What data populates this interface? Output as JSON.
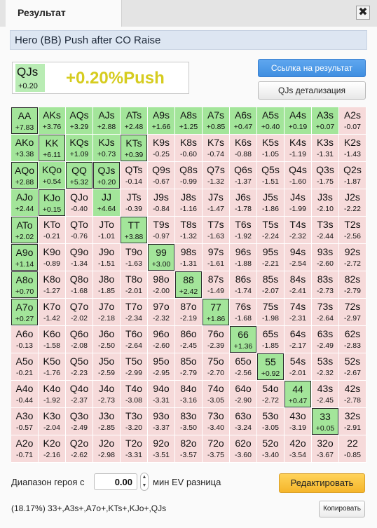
{
  "window": {
    "tab_title": "Результат",
    "close_glyph": "✖"
  },
  "scenario_title": "Hero (BB) Push after CO Raise",
  "selected_hand": {
    "name": "QJs",
    "ev": "+0.20",
    "result_text": "+0.20%Push"
  },
  "buttons": {
    "link": "Ссылка на результат",
    "details": "QJs детализация",
    "edit": "Редактировать",
    "copy": "Копировать"
  },
  "range": {
    "label": "Диапазон героя с",
    "value": "0.00",
    "suffix": "мин EV разница"
  },
  "summary": "(18.17%) 33+,A3s+,A7o+,KTs+,KJo+,QJs",
  "colors": {
    "push_green": "#a3e59a",
    "fold_pink": "#f6dada",
    "selected_green": "#b9ecb4",
    "result_yellow": "#d6cc1f",
    "link_button": "#4a97e8",
    "edit_button": "#f8c23f"
  },
  "grid": [
    [
      {
        "n": "AA",
        "v": "+7.83",
        "p": true,
        "s": true
      },
      {
        "n": "AKs",
        "v": "+3.76",
        "p": true,
        "s": false
      },
      {
        "n": "AQs",
        "v": "+3.29",
        "p": true,
        "s": false
      },
      {
        "n": "AJs",
        "v": "+2.88",
        "p": true,
        "s": false
      },
      {
        "n": "ATs",
        "v": "+2.48",
        "p": true,
        "s": false
      },
      {
        "n": "A9s",
        "v": "+1.66",
        "p": true,
        "s": false
      },
      {
        "n": "A8s",
        "v": "+1.25",
        "p": true,
        "s": false
      },
      {
        "n": "A7s",
        "v": "+0.85",
        "p": true,
        "s": false
      },
      {
        "n": "A6s",
        "v": "+0.47",
        "p": true,
        "s": false
      },
      {
        "n": "A5s",
        "v": "+0.40",
        "p": true,
        "s": false
      },
      {
        "n": "A4s",
        "v": "+0.19",
        "p": true,
        "s": false
      },
      {
        "n": "A3s",
        "v": "+0.07",
        "p": true,
        "s": false
      },
      {
        "n": "A2s",
        "v": "-0.07",
        "p": false,
        "s": false
      }
    ],
    [
      {
        "n": "AKo",
        "v": "+3.38",
        "p": true,
        "s": false
      },
      {
        "n": "KK",
        "v": "+6.11",
        "p": true,
        "s": true
      },
      {
        "n": "KQs",
        "v": "+1.09",
        "p": true,
        "s": false
      },
      {
        "n": "KJs",
        "v": "+0.73",
        "p": true,
        "s": false
      },
      {
        "n": "KTs",
        "v": "+0.39",
        "p": true,
        "s": true
      },
      {
        "n": "K9s",
        "v": "-0.25",
        "p": false,
        "s": false
      },
      {
        "n": "K8s",
        "v": "-0.60",
        "p": false,
        "s": false
      },
      {
        "n": "K7s",
        "v": "-0.74",
        "p": false,
        "s": false
      },
      {
        "n": "K6s",
        "v": "-0.88",
        "p": false,
        "s": false
      },
      {
        "n": "K5s",
        "v": "-1.05",
        "p": false,
        "s": false
      },
      {
        "n": "K4s",
        "v": "-1.19",
        "p": false,
        "s": false
      },
      {
        "n": "K3s",
        "v": "-1.31",
        "p": false,
        "s": false
      },
      {
        "n": "K2s",
        "v": "-1.43",
        "p": false,
        "s": false
      }
    ],
    [
      {
        "n": "AQo",
        "v": "+2.88",
        "p": true,
        "s": true
      },
      {
        "n": "KQo",
        "v": "+0.54",
        "p": true,
        "s": false
      },
      {
        "n": "QQ",
        "v": "+5.32",
        "p": true,
        "s": true
      },
      {
        "n": "QJs",
        "v": "+0.20",
        "p": true,
        "s": true
      },
      {
        "n": "QTs",
        "v": "-0.14",
        "p": false,
        "s": false
      },
      {
        "n": "Q9s",
        "v": "-0.67",
        "p": false,
        "s": false
      },
      {
        "n": "Q8s",
        "v": "-0.99",
        "p": false,
        "s": false
      },
      {
        "n": "Q7s",
        "v": "-1.32",
        "p": false,
        "s": false
      },
      {
        "n": "Q6s",
        "v": "-1.37",
        "p": false,
        "s": false
      },
      {
        "n": "Q5s",
        "v": "-1.51",
        "p": false,
        "s": false
      },
      {
        "n": "Q4s",
        "v": "-1.60",
        "p": false,
        "s": false
      },
      {
        "n": "Q3s",
        "v": "-1.75",
        "p": false,
        "s": false
      },
      {
        "n": "Q2s",
        "v": "-1.87",
        "p": false,
        "s": false
      }
    ],
    [
      {
        "n": "AJo",
        "v": "+2.44",
        "p": true,
        "s": false
      },
      {
        "n": "KJo",
        "v": "+0.15",
        "p": true,
        "s": true
      },
      {
        "n": "QJo",
        "v": "-0.40",
        "p": false,
        "s": false
      },
      {
        "n": "JJ",
        "v": "+4.64",
        "p": true,
        "s": false
      },
      {
        "n": "JTs",
        "v": "-0.39",
        "p": false,
        "s": false
      },
      {
        "n": "J9s",
        "v": "-0.84",
        "p": false,
        "s": false
      },
      {
        "n": "J8s",
        "v": "-1.16",
        "p": false,
        "s": false
      },
      {
        "n": "J7s",
        "v": "-1.47",
        "p": false,
        "s": false
      },
      {
        "n": "J6s",
        "v": "-1.78",
        "p": false,
        "s": false
      },
      {
        "n": "J5s",
        "v": "-1.86",
        "p": false,
        "s": false
      },
      {
        "n": "J4s",
        "v": "-1.99",
        "p": false,
        "s": false
      },
      {
        "n": "J3s",
        "v": "-2.10",
        "p": false,
        "s": false
      },
      {
        "n": "J2s",
        "v": "-2.22",
        "p": false,
        "s": false
      }
    ],
    [
      {
        "n": "ATo",
        "v": "+2.02",
        "p": true,
        "s": true
      },
      {
        "n": "KTo",
        "v": "-0.21",
        "p": false,
        "s": false
      },
      {
        "n": "QTo",
        "v": "-0.76",
        "p": false,
        "s": false
      },
      {
        "n": "JTo",
        "v": "-1.01",
        "p": false,
        "s": false
      },
      {
        "n": "TT",
        "v": "+3.88",
        "p": true,
        "s": true
      },
      {
        "n": "T9s",
        "v": "-0.97",
        "p": false,
        "s": false
      },
      {
        "n": "T8s",
        "v": "-1.32",
        "p": false,
        "s": false
      },
      {
        "n": "T7s",
        "v": "-1.63",
        "p": false,
        "s": false
      },
      {
        "n": "T6s",
        "v": "-1.92",
        "p": false,
        "s": false
      },
      {
        "n": "T5s",
        "v": "-2.24",
        "p": false,
        "s": false
      },
      {
        "n": "T4s",
        "v": "-2.32",
        "p": false,
        "s": false
      },
      {
        "n": "T3s",
        "v": "-2.44",
        "p": false,
        "s": false
      },
      {
        "n": "T2s",
        "v": "-2.56",
        "p": false,
        "s": false
      }
    ],
    [
      {
        "n": "A9o",
        "v": "+1.14",
        "p": true,
        "s": true
      },
      {
        "n": "K9o",
        "v": "-0.89",
        "p": false,
        "s": false
      },
      {
        "n": "Q9o",
        "v": "-1.34",
        "p": false,
        "s": false
      },
      {
        "n": "J9o",
        "v": "-1.51",
        "p": false,
        "s": false
      },
      {
        "n": "T9o",
        "v": "-1.63",
        "p": false,
        "s": false
      },
      {
        "n": "99",
        "v": "+3.00",
        "p": true,
        "s": true
      },
      {
        "n": "98s",
        "v": "-1.31",
        "p": false,
        "s": false
      },
      {
        "n": "97s",
        "v": "-1.61",
        "p": false,
        "s": false
      },
      {
        "n": "96s",
        "v": "-1.88",
        "p": false,
        "s": false
      },
      {
        "n": "95s",
        "v": "-2.21",
        "p": false,
        "s": false
      },
      {
        "n": "94s",
        "v": "-2.54",
        "p": false,
        "s": false
      },
      {
        "n": "93s",
        "v": "-2.60",
        "p": false,
        "s": false
      },
      {
        "n": "92s",
        "v": "-2.72",
        "p": false,
        "s": false
      }
    ],
    [
      {
        "n": "A8o",
        "v": "+0.70",
        "p": true,
        "s": true
      },
      {
        "n": "K8o",
        "v": "-1.27",
        "p": false,
        "s": false
      },
      {
        "n": "Q8o",
        "v": "-1.68",
        "p": false,
        "s": false
      },
      {
        "n": "J8o",
        "v": "-1.85",
        "p": false,
        "s": false
      },
      {
        "n": "T8o",
        "v": "-2.01",
        "p": false,
        "s": false
      },
      {
        "n": "98o",
        "v": "-2.00",
        "p": false,
        "s": false
      },
      {
        "n": "88",
        "v": "+2.42",
        "p": true,
        "s": true
      },
      {
        "n": "87s",
        "v": "-1.49",
        "p": false,
        "s": false
      },
      {
        "n": "86s",
        "v": "-1.74",
        "p": false,
        "s": false
      },
      {
        "n": "85s",
        "v": "-2.07",
        "p": false,
        "s": false
      },
      {
        "n": "84s",
        "v": "-2.41",
        "p": false,
        "s": false
      },
      {
        "n": "83s",
        "v": "-2.73",
        "p": false,
        "s": false
      },
      {
        "n": "82s",
        "v": "-2.79",
        "p": false,
        "s": false
      }
    ],
    [
      {
        "n": "A7o",
        "v": "+0.27",
        "p": true,
        "s": true
      },
      {
        "n": "K7o",
        "v": "-1.42",
        "p": false,
        "s": false
      },
      {
        "n": "Q7o",
        "v": "-2.02",
        "p": false,
        "s": false
      },
      {
        "n": "J7o",
        "v": "-2.18",
        "p": false,
        "s": false
      },
      {
        "n": "T7o",
        "v": "-2.34",
        "p": false,
        "s": false
      },
      {
        "n": "97o",
        "v": "-2.32",
        "p": false,
        "s": false
      },
      {
        "n": "87o",
        "v": "-2.19",
        "p": false,
        "s": false
      },
      {
        "n": "77",
        "v": "+1.86",
        "p": true,
        "s": true
      },
      {
        "n": "76s",
        "v": "-1.68",
        "p": false,
        "s": false
      },
      {
        "n": "75s",
        "v": "-1.98",
        "p": false,
        "s": false
      },
      {
        "n": "74s",
        "v": "-2.31",
        "p": false,
        "s": false
      },
      {
        "n": "73s",
        "v": "-2.64",
        "p": false,
        "s": false
      },
      {
        "n": "72s",
        "v": "-2.97",
        "p": false,
        "s": false
      }
    ],
    [
      {
        "n": "A6o",
        "v": "-0.13",
        "p": false,
        "s": false
      },
      {
        "n": "K6o",
        "v": "-1.58",
        "p": false,
        "s": false
      },
      {
        "n": "Q6o",
        "v": "-2.08",
        "p": false,
        "s": false
      },
      {
        "n": "J6o",
        "v": "-2.50",
        "p": false,
        "s": false
      },
      {
        "n": "T6o",
        "v": "-2.64",
        "p": false,
        "s": false
      },
      {
        "n": "96o",
        "v": "-2.60",
        "p": false,
        "s": false
      },
      {
        "n": "86o",
        "v": "-2.45",
        "p": false,
        "s": false
      },
      {
        "n": "76o",
        "v": "-2.39",
        "p": false,
        "s": false
      },
      {
        "n": "66",
        "v": "+1.36",
        "p": true,
        "s": true
      },
      {
        "n": "65s",
        "v": "-1.85",
        "p": false,
        "s": false
      },
      {
        "n": "64s",
        "v": "-2.17",
        "p": false,
        "s": false
      },
      {
        "n": "63s",
        "v": "-2.49",
        "p": false,
        "s": false
      },
      {
        "n": "62s",
        "v": "-2.83",
        "p": false,
        "s": false
      }
    ],
    [
      {
        "n": "A5o",
        "v": "-0.21",
        "p": false,
        "s": false
      },
      {
        "n": "K5o",
        "v": "-1.76",
        "p": false,
        "s": false
      },
      {
        "n": "Q5o",
        "v": "-2.23",
        "p": false,
        "s": false
      },
      {
        "n": "J5o",
        "v": "-2.59",
        "p": false,
        "s": false
      },
      {
        "n": "T5o",
        "v": "-2.99",
        "p": false,
        "s": false
      },
      {
        "n": "95o",
        "v": "-2.95",
        "p": false,
        "s": false
      },
      {
        "n": "85o",
        "v": "-2.79",
        "p": false,
        "s": false
      },
      {
        "n": "75o",
        "v": "-2.70",
        "p": false,
        "s": false
      },
      {
        "n": "65o",
        "v": "-2.56",
        "p": false,
        "s": false
      },
      {
        "n": "55",
        "v": "+0.92",
        "p": true,
        "s": true
      },
      {
        "n": "54s",
        "v": "-2.01",
        "p": false,
        "s": false
      },
      {
        "n": "53s",
        "v": "-2.32",
        "p": false,
        "s": false
      },
      {
        "n": "52s",
        "v": "-2.67",
        "p": false,
        "s": false
      }
    ],
    [
      {
        "n": "A4o",
        "v": "-0.44",
        "p": false,
        "s": false
      },
      {
        "n": "K4o",
        "v": "-1.92",
        "p": false,
        "s": false
      },
      {
        "n": "Q4o",
        "v": "-2.37",
        "p": false,
        "s": false
      },
      {
        "n": "J4o",
        "v": "-2.73",
        "p": false,
        "s": false
      },
      {
        "n": "T4o",
        "v": "-3.08",
        "p": false,
        "s": false
      },
      {
        "n": "94o",
        "v": "-3.31",
        "p": false,
        "s": false
      },
      {
        "n": "84o",
        "v": "-3.16",
        "p": false,
        "s": false
      },
      {
        "n": "74o",
        "v": "-3.05",
        "p": false,
        "s": false
      },
      {
        "n": "64o",
        "v": "-2.90",
        "p": false,
        "s": false
      },
      {
        "n": "54o",
        "v": "-2.72",
        "p": false,
        "s": false
      },
      {
        "n": "44",
        "v": "+0.47",
        "p": true,
        "s": true
      },
      {
        "n": "43s",
        "v": "-2.45",
        "p": false,
        "s": false
      },
      {
        "n": "42s",
        "v": "-2.78",
        "p": false,
        "s": false
      }
    ],
    [
      {
        "n": "A3o",
        "v": "-0.57",
        "p": false,
        "s": false
      },
      {
        "n": "K3o",
        "v": "-2.04",
        "p": false,
        "s": false
      },
      {
        "n": "Q3o",
        "v": "-2.49",
        "p": false,
        "s": false
      },
      {
        "n": "J3o",
        "v": "-2.85",
        "p": false,
        "s": false
      },
      {
        "n": "T3o",
        "v": "-3.20",
        "p": false,
        "s": false
      },
      {
        "n": "93o",
        "v": "-3.37",
        "p": false,
        "s": false
      },
      {
        "n": "83o",
        "v": "-3.50",
        "p": false,
        "s": false
      },
      {
        "n": "73o",
        "v": "-3.40",
        "p": false,
        "s": false
      },
      {
        "n": "63o",
        "v": "-3.24",
        "p": false,
        "s": false
      },
      {
        "n": "53o",
        "v": "-3.05",
        "p": false,
        "s": false
      },
      {
        "n": "43o",
        "v": "-3.19",
        "p": false,
        "s": false
      },
      {
        "n": "33",
        "v": "+0.05",
        "p": true,
        "s": true
      },
      {
        "n": "32s",
        "v": "-2.91",
        "p": false,
        "s": false
      }
    ],
    [
      {
        "n": "A2o",
        "v": "-0.71",
        "p": false,
        "s": false
      },
      {
        "n": "K2o",
        "v": "-2.16",
        "p": false,
        "s": false
      },
      {
        "n": "Q2o",
        "v": "-2.62",
        "p": false,
        "s": false
      },
      {
        "n": "J2o",
        "v": "-2.98",
        "p": false,
        "s": false
      },
      {
        "n": "T2o",
        "v": "-3.31",
        "p": false,
        "s": false
      },
      {
        "n": "92o",
        "v": "-3.51",
        "p": false,
        "s": false
      },
      {
        "n": "82o",
        "v": "-3.57",
        "p": false,
        "s": false
      },
      {
        "n": "72o",
        "v": "-3.75",
        "p": false,
        "s": false
      },
      {
        "n": "62o",
        "v": "-3.60",
        "p": false,
        "s": false
      },
      {
        "n": "52o",
        "v": "-3.40",
        "p": false,
        "s": false
      },
      {
        "n": "42o",
        "v": "-3.54",
        "p": false,
        "s": false
      },
      {
        "n": "32o",
        "v": "-3.67",
        "p": false,
        "s": false
      },
      {
        "n": "22",
        "v": "-0.85",
        "p": false,
        "s": false
      }
    ]
  ]
}
